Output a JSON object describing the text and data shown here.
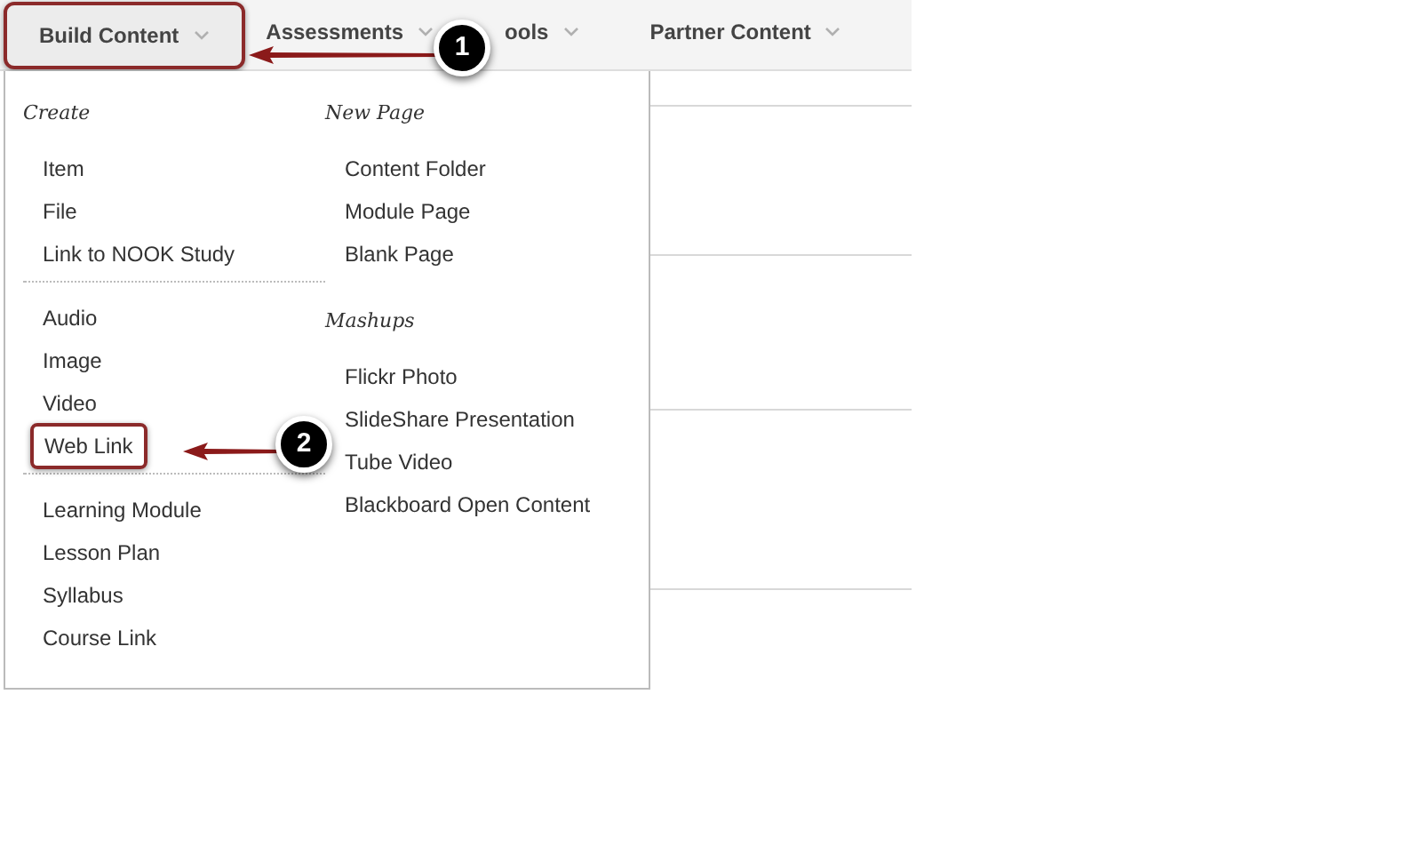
{
  "nav_tabs": [
    {
      "label": "Build Content",
      "selected": true
    },
    {
      "label": "Assessments",
      "selected": false
    },
    {
      "label": "ools",
      "selected": false
    },
    {
      "label": "Partner Content",
      "selected": false
    }
  ],
  "menu": {
    "columns": [
      {
        "groups": [
          {
            "heading": "Create",
            "items": [
              {
                "label": "Item",
                "highlighted": false
              },
              {
                "label": "File",
                "highlighted": false
              },
              {
                "label": "Link to NOOK Study",
                "highlighted": false
              }
            ]
          },
          {
            "items": [
              {
                "label": "Audio",
                "highlighted": false
              },
              {
                "label": "Image",
                "highlighted": false
              },
              {
                "label": "Video",
                "highlighted": false
              },
              {
                "label": "Web Link",
                "highlighted": true
              }
            ]
          },
          {
            "items": [
              {
                "label": "Learning Module",
                "highlighted": false
              },
              {
                "label": "Lesson Plan",
                "highlighted": false
              },
              {
                "label": "Syllabus",
                "highlighted": false
              },
              {
                "label": "Course Link",
                "highlighted": false
              }
            ]
          }
        ]
      },
      {
        "groups": [
          {
            "heading": "New Page",
            "items": [
              {
                "label": "Content Folder",
                "highlighted": false
              },
              {
                "label": "Module Page",
                "highlighted": false
              },
              {
                "label": "Blank Page",
                "highlighted": false
              }
            ]
          },
          {
            "heading": "Mashups",
            "items": [
              {
                "label": "Flickr Photo",
                "highlighted": false
              },
              {
                "label": "SlideShare Presentation",
                "highlighted": false
              },
              {
                "label": "Tube Video",
                "highlighted": false
              },
              {
                "label": "Blackboard Open Content",
                "highlighted": false
              }
            ]
          }
        ]
      }
    ]
  },
  "callouts": [
    "1",
    "2"
  ]
}
